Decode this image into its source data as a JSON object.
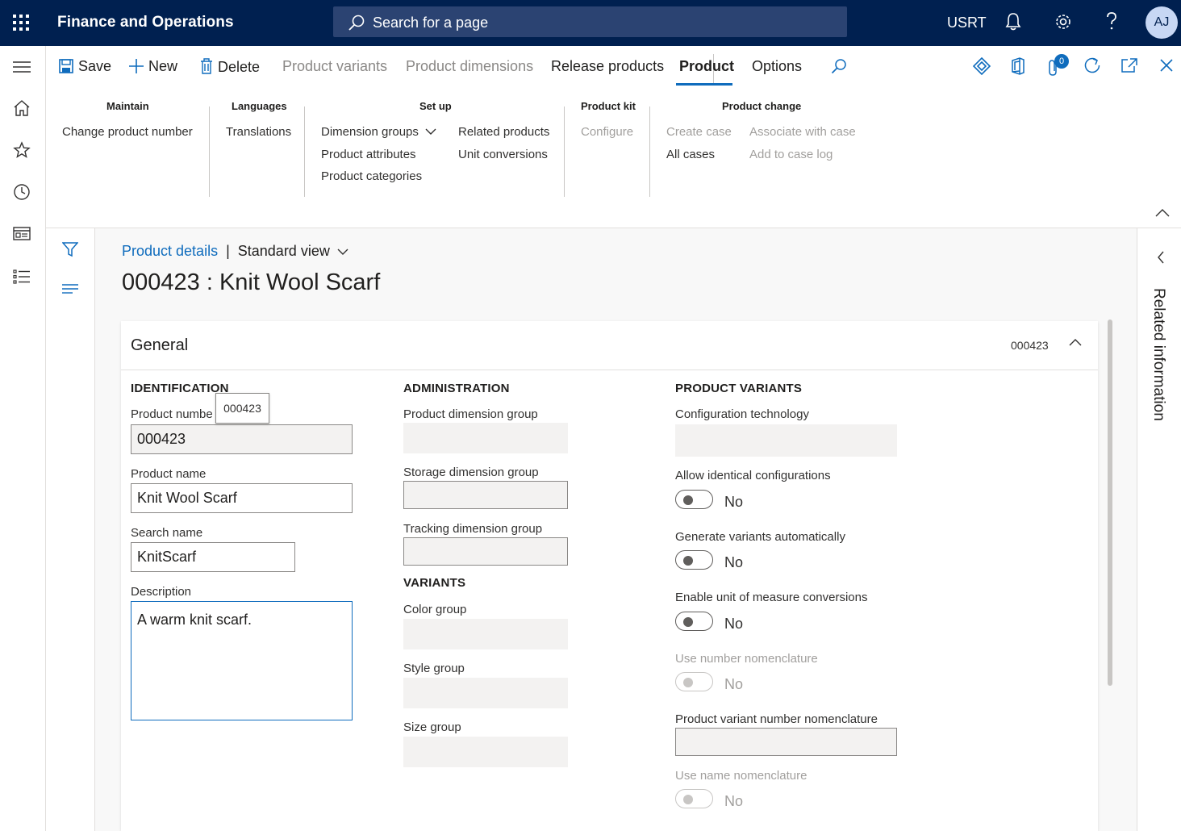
{
  "app": {
    "title": "Finance and Operations",
    "company": "USRT",
    "user_initials": "AJ"
  },
  "search": {
    "placeholder": "Search for a page"
  },
  "toolbar": {
    "save": "Save",
    "new": "New",
    "delete": "Delete",
    "product_variants": "Product variants",
    "product_dimensions": "Product dimensions",
    "release_products": "Release products",
    "tab_product": "Product",
    "tab_options": "Options",
    "attachments_count": "0"
  },
  "ribbon": {
    "maintain": {
      "title": "Maintain",
      "items": [
        "Change product number"
      ]
    },
    "languages": {
      "title": "Languages",
      "items": [
        "Translations"
      ]
    },
    "setup": {
      "title": "Set up",
      "items": [
        "Dimension groups",
        "Product attributes",
        "Product categories",
        "Related products",
        "Unit conversions"
      ]
    },
    "product_kit": {
      "title": "Product kit",
      "items": [
        "Configure"
      ]
    },
    "product_change": {
      "title": "Product change",
      "items": [
        "Create case",
        "All cases",
        "Associate with case",
        "Add to case log"
      ]
    }
  },
  "page": {
    "breadcrumb_link": "Product details",
    "breadcrumb_sep": "|",
    "view": "Standard view",
    "title": "000423 : Knit Wool Scarf"
  },
  "general": {
    "title": "General",
    "summary": "000423",
    "identification": {
      "title": "IDENTIFICATION",
      "product_number_label": "Product numbe",
      "product_number": "000423",
      "tooltip": "000423",
      "product_name_label": "Product name",
      "product_name": "Knit Wool Scarf",
      "search_name_label": "Search name",
      "search_name": "KnitScarf",
      "description_label": "Description",
      "description": "A warm knit scarf."
    },
    "administration": {
      "title": "ADMINISTRATION",
      "product_dimension_group": "Product dimension group",
      "storage_dimension_group": "Storage dimension group",
      "tracking_dimension_group": "Tracking dimension group"
    },
    "variants": {
      "title": "VARIANTS",
      "color_group": "Color group",
      "style_group": "Style group",
      "size_group": "Size group"
    },
    "product_variants": {
      "title": "PRODUCT VARIANTS",
      "configuration_technology": "Configuration technology",
      "allow_identical": "Allow identical configurations",
      "allow_identical_value": "No",
      "generate_variants": "Generate variants automatically",
      "generate_variants_value": "No",
      "enable_uom": "Enable unit of measure conversions",
      "enable_uom_value": "No",
      "use_number_nomenclature": "Use number nomenclature",
      "use_number_nomenclature_value": "No",
      "variant_number_nomenclature": "Product variant number nomenclature",
      "use_name_nomenclature": "Use name nomenclature",
      "use_name_nomenclature_value": "No"
    }
  },
  "related_panel": {
    "label": "Related information"
  }
}
